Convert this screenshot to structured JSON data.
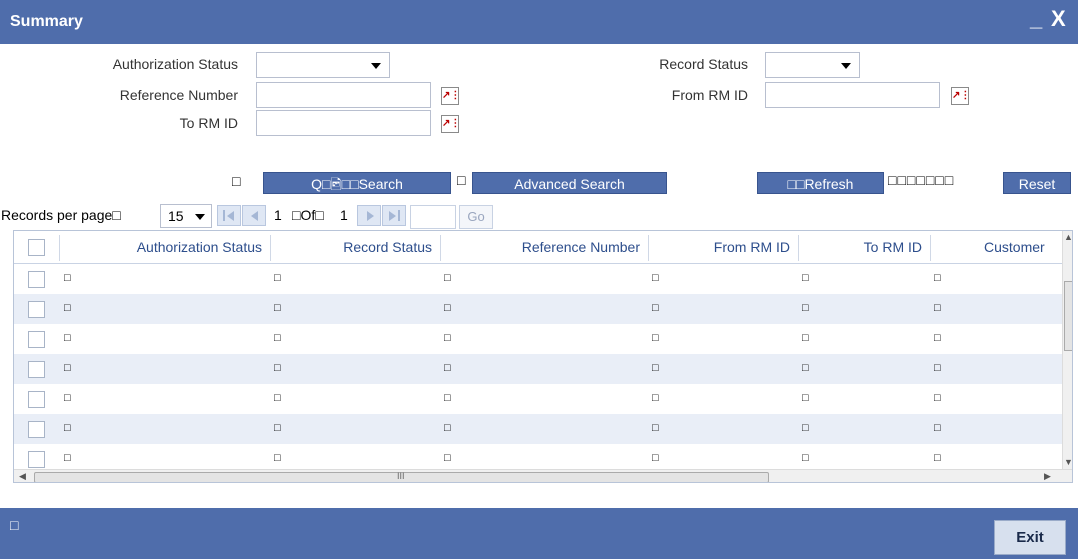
{
  "window": {
    "title": "Summary",
    "minimize": "_",
    "close": "X"
  },
  "filters": {
    "authorization_status_label": "Authorization Status",
    "record_status_label": "Record Status",
    "reference_number_label": "Reference Number",
    "from_rm_id_label": "From RM ID",
    "to_rm_id_label": "To RM ID",
    "authorization_status_value": "",
    "record_status_value": "",
    "reference_number_value": "",
    "from_rm_id_value": "",
    "to_rm_id_value": ""
  },
  "actions": {
    "search_label": "Q□🖻□□Search",
    "advanced_search_label": "Advanced Search",
    "refresh_label": "□□Refresh",
    "reset_label": "Reset",
    "placeholder_square": "□",
    "placeholder_squares": "□□□□□□□"
  },
  "pager": {
    "records_per_page_label": "Records per page□",
    "records_per_page_value": "15",
    "current_page": "1",
    "of_label": "□Of□",
    "total_pages": "1",
    "go_label": "Go"
  },
  "grid": {
    "columns": [
      "Authorization Status",
      "Record Status",
      "Reference Number",
      "From RM ID",
      "To RM ID",
      "Customer"
    ],
    "rows": [
      [
        "□",
        "□",
        "□",
        "□",
        "□",
        "□"
      ],
      [
        "□",
        "□",
        "□",
        "□",
        "□",
        "□"
      ],
      [
        "□",
        "□",
        "□",
        "□",
        "□",
        "□"
      ],
      [
        "□",
        "□",
        "□",
        "□",
        "□",
        "□"
      ],
      [
        "□",
        "□",
        "□",
        "□",
        "□",
        "□"
      ],
      [
        "□",
        "□",
        "□",
        "□",
        "□",
        "□"
      ],
      [
        "□",
        "□",
        "□",
        "□",
        "□",
        "□"
      ]
    ],
    "hscroll_mark": "III"
  },
  "footer": {
    "status_glyph": "□",
    "exit_label": "Exit"
  },
  "colors": {
    "accent": "#4f6dab",
    "header_text": "#2d4e8c",
    "row_alt": "#e9eef7"
  }
}
